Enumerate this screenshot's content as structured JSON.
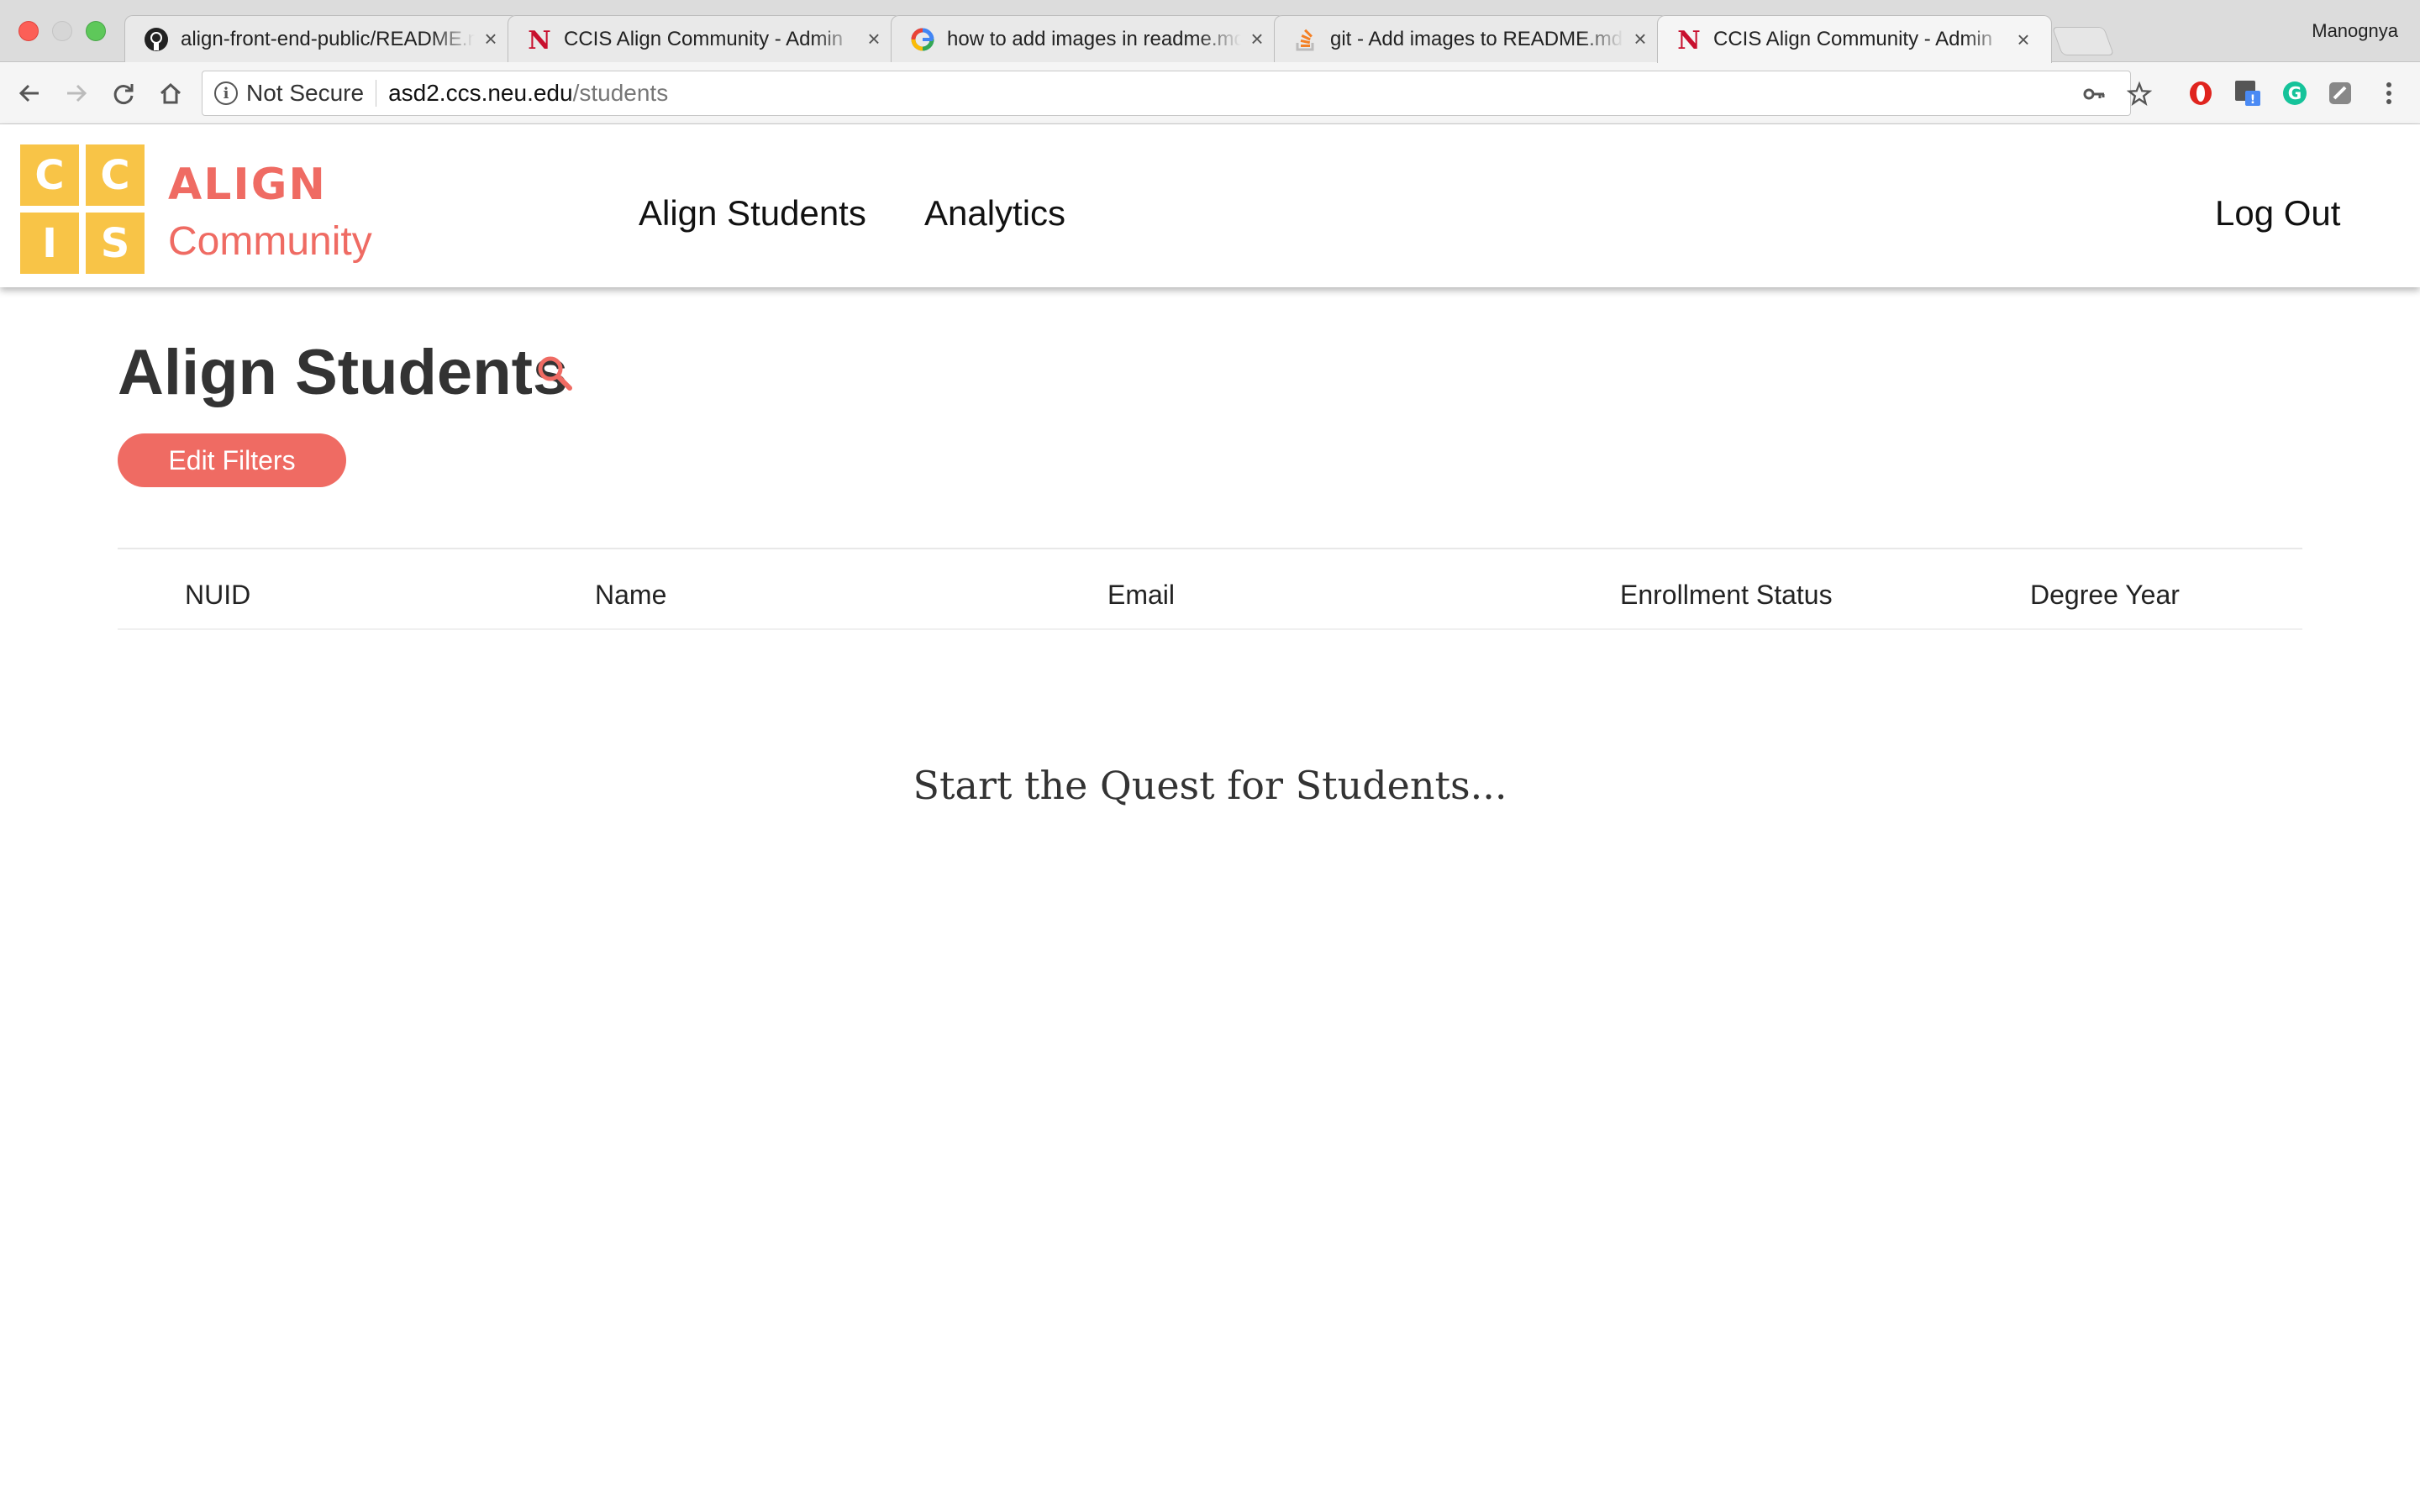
{
  "browser": {
    "tabs": [
      {
        "title": "align-front-end-public/README.md",
        "icon": "github-icon"
      },
      {
        "title": "CCIS Align Community - Admin",
        "icon": "northeastern-n-icon"
      },
      {
        "title": "how to add images in readme.md",
        "icon": "google-g-icon"
      },
      {
        "title": "git - Add images to README.md",
        "icon": "stackoverflow-icon"
      },
      {
        "title": "CCIS Align Community - Admin",
        "icon": "northeastern-n-icon"
      }
    ],
    "close_glyph": "×",
    "profile_name": "Manognya",
    "address": {
      "security_label": "Not Secure",
      "host": "asd2.ccs.neu.edu",
      "path": "/students"
    }
  },
  "site": {
    "logo_letters": [
      "C",
      "C",
      "I",
      "S"
    ],
    "brand_title": "ALIGN",
    "brand_subtitle": "Community",
    "nav": {
      "align_students": "Align Students",
      "analytics": "Analytics",
      "logout": "Log Out"
    }
  },
  "main": {
    "title": "Align Students",
    "edit_filters": "Edit Filters",
    "columns": [
      "NUID",
      "Name",
      "Email",
      "Enrollment Status",
      "Degree Year"
    ],
    "empty_message": "Start the Quest for Students..."
  },
  "colors": {
    "brand_coral": "#ef6b63",
    "logo_yellow": "#f8c447"
  }
}
